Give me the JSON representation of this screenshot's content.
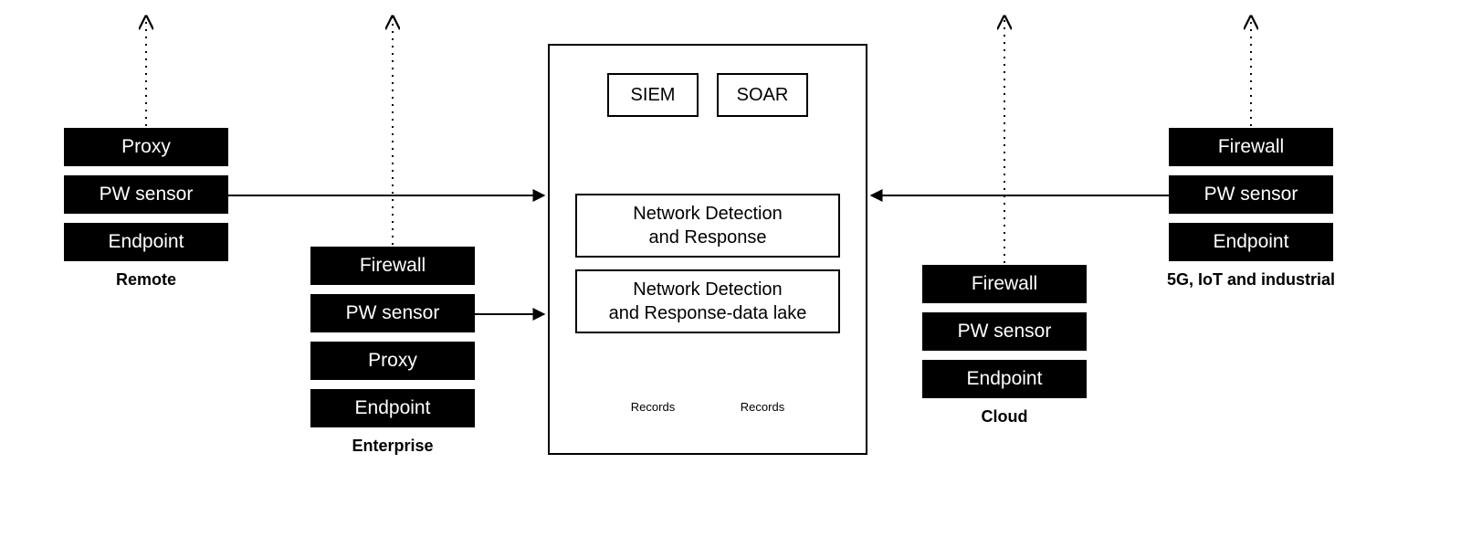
{
  "stacks": {
    "remote": {
      "label": "Remote",
      "items": [
        "Proxy",
        "PW sensor",
        "Endpoint"
      ]
    },
    "enterprise": {
      "label": "Enterprise",
      "items": [
        "Firewall",
        "PW sensor",
        "Proxy",
        "Endpoint"
      ]
    },
    "cloud": {
      "label": "Cloud",
      "items": [
        "Firewall",
        "PW sensor",
        "Endpoint"
      ]
    },
    "iot": {
      "label": "5G, IoT and industrial",
      "items": [
        "Firewall",
        "PW sensor",
        "Endpoint"
      ]
    }
  },
  "central": {
    "siem": "SIEM",
    "soar": "SOAR",
    "ndr1": "Network Detection\nand Response",
    "ndr2": "Network Detection\nand Response-data lake",
    "records1": "Records",
    "records2": "Records"
  }
}
